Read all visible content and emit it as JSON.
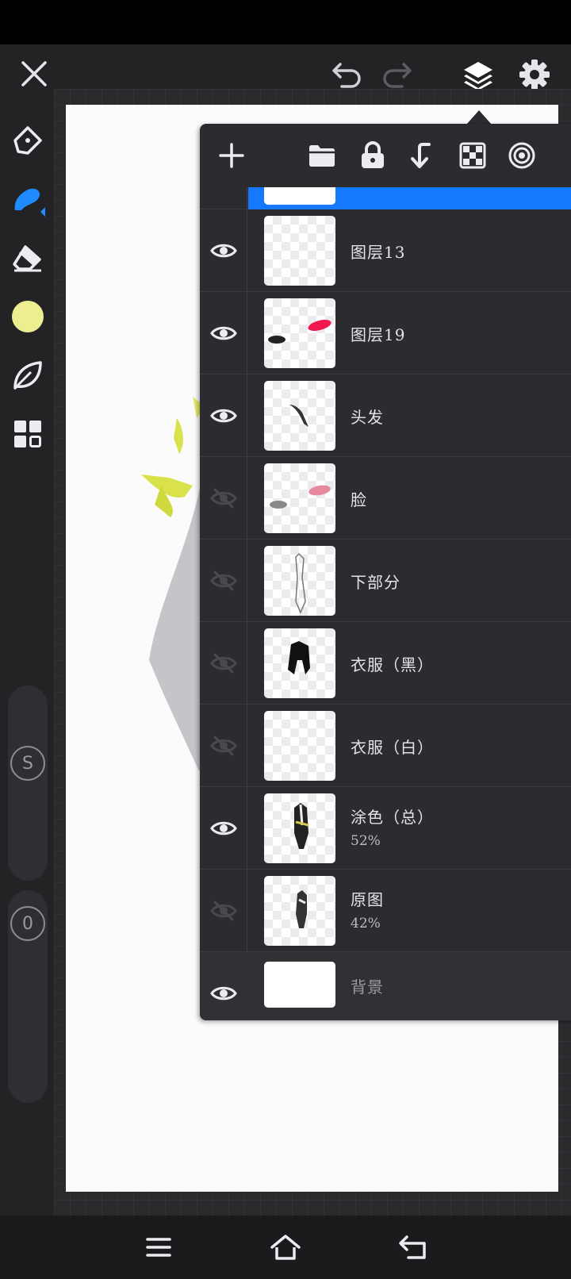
{
  "topbar": {
    "close_icon": "close-icon",
    "undo_icon": "undo-icon",
    "redo_icon": "redo-icon",
    "layers_icon": "layers-icon",
    "settings_icon": "gear-icon"
  },
  "left_tools": {
    "items": [
      "pen-tool",
      "brush-tool",
      "eraser-tool",
      "color-swatch",
      "smudge-tool",
      "gallery-tool"
    ],
    "color": "#ECEE8F",
    "active_color": "#1E8BFF",
    "size_slider_label": "S",
    "opacity_slider_label": "0"
  },
  "layers_toolbar": {
    "items": [
      "add-layer",
      "folder",
      "lock",
      "merge-down",
      "transparency-lock",
      "clipping"
    ]
  },
  "layers": [
    {
      "name": "图层13",
      "opacity": "",
      "visible": true
    },
    {
      "name": "图层19",
      "opacity": "",
      "visible": true
    },
    {
      "name": "头发",
      "opacity": "",
      "visible": true
    },
    {
      "name": "脸",
      "opacity": "",
      "visible": false
    },
    {
      "name": "下部分",
      "opacity": "",
      "visible": false
    },
    {
      "name": "衣服（黑）",
      "opacity": "",
      "visible": false
    },
    {
      "name": "衣服（白）",
      "opacity": "",
      "visible": false
    },
    {
      "name": "涂色（总）",
      "opacity": "52%",
      "visible": true
    },
    {
      "name": "原图",
      "opacity": "42%",
      "visible": false
    },
    {
      "name": "背景",
      "opacity": "",
      "visible": true
    }
  ],
  "navbar": {
    "menu_icon": "menu-icon",
    "home_icon": "home-icon",
    "back_icon": "back-icon"
  },
  "colors": {
    "selected_layer": "#1479FF",
    "panel_bg": "#2C2C30",
    "toolbar_bg": "#232326"
  }
}
